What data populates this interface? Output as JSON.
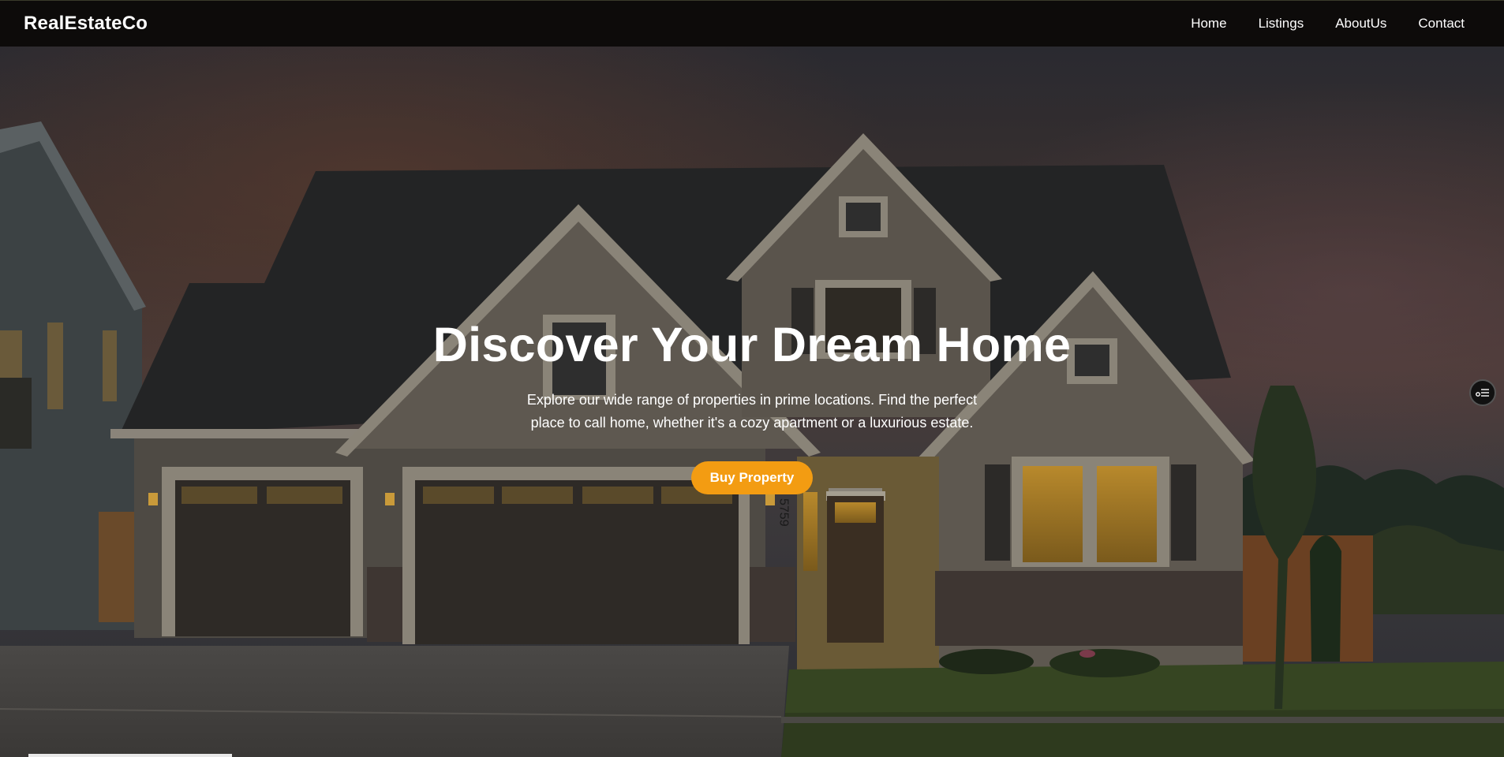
{
  "navbar": {
    "brand": "RealEstateCo",
    "links": [
      "Home",
      "Listings",
      "AboutUs",
      "Contact"
    ]
  },
  "hero": {
    "title": "Discover Your Dream Home",
    "subtitle": "Explore our wide range of properties in prime locations. Find the perfect place to call home, whether it's a cozy apartment or a luxurious estate.",
    "cta_label": "Buy Property",
    "house_number": "5759"
  },
  "icons": {
    "side_widget": "accessibility-menu-icon"
  },
  "colors": {
    "navbar_bg": "#0d0b0a",
    "accent": "#f39c12",
    "text": "#ffffff"
  }
}
